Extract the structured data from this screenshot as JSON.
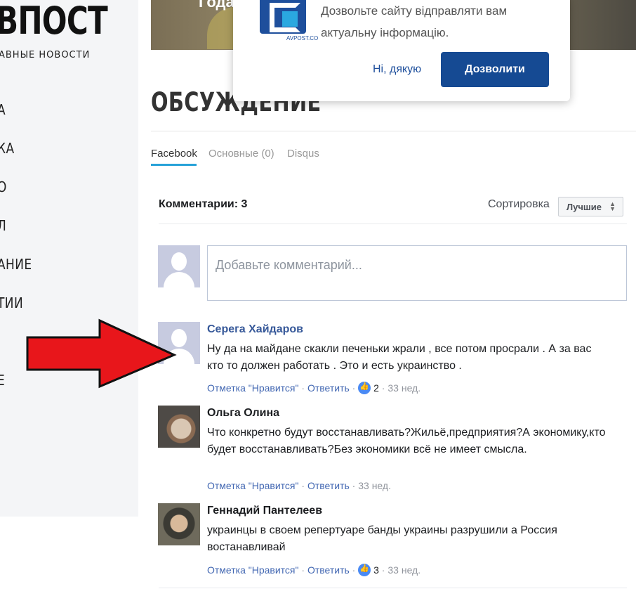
{
  "site": {
    "logo": "ВПОСТ",
    "tagline": "АВНЫЕ НОВОСТИ",
    "nav": [
      "А",
      "КА",
      "О",
      "Л",
      "АНИЕ",
      "ТИИ",
      "Е"
    ]
  },
  "hero": {
    "text": "Года"
  },
  "popup": {
    "logo_text": "AVPOST.CO",
    "message": "Дозвольте сайту відправляти вам актуальну інформацію.",
    "decline_label": "Ні, дякую",
    "allow_label": "Дозволити"
  },
  "discussion": {
    "title": "ОБСУЖДЕНИЕ",
    "tabs": [
      {
        "label": "Facebook",
        "active": true
      },
      {
        "label": "Основные (0)",
        "active": false
      },
      {
        "label": "Disqus",
        "active": false
      }
    ]
  },
  "fb": {
    "count_label": "Комментарии: 3",
    "sort_label": "Сортировка",
    "sort_value": "Лучшие",
    "input_placeholder": "Добавьте комментарий...",
    "comments": [
      {
        "author": "Серега Хайдаров",
        "text": "Ну да на майдане скакли печеньки жрали , все потом просрали . А за вас кто то должен работать . Это и есть украинство .",
        "like_label": "Отметка \"Нравится\"",
        "reply_label": "Ответить",
        "likes": "2",
        "time": "33 нед."
      },
      {
        "author": "Ольга Олина",
        "text": "Что конкретно будут восстанавливать?Жильё,предприятия?А экономику,кто будет восстанавливать?Без экономики всё не имеет смысла.",
        "like_label": "Отметка \"Нравится\"",
        "reply_label": "Ответить",
        "time": "33 нед."
      },
      {
        "author": "Геннадий Пантелеев",
        "text": "украинцы в своем репертуаре банды украины разрушили а Россия востанавливай",
        "like_label": "Отметка \"Нравится\"",
        "reply_label": "Ответить",
        "likes": "3",
        "time": "33 нед."
      }
    ]
  },
  "colors": {
    "accent": "#27a2d8",
    "fb_link": "#4267b2",
    "primary_button": "#154a93",
    "arrow_red": "#e8161b"
  }
}
